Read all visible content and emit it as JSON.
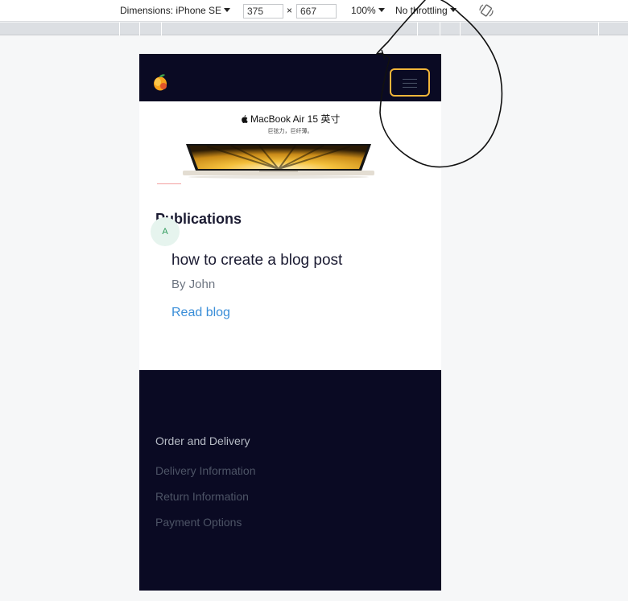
{
  "devtools": {
    "dimensions_label": "Dimensions: iPhone SE",
    "width_value": "375",
    "times": "×",
    "height_value": "667",
    "zoom": "100%",
    "throttling": "No throttling",
    "rotate_icon": "rotate-icon"
  },
  "nav": {
    "logo_icon": "mango-logo-icon",
    "menu_icon": "hamburger-menu-icon",
    "accent_color": "#f1b53a",
    "background_color": "#0a0a23"
  },
  "banner": {
    "title": "MacBook Air 15 英寸",
    "subtitle": "巨弦力，巨纤薄。"
  },
  "publications": {
    "heading": "Publications",
    "avatar_letter": "A",
    "posts": [
      {
        "title": "how to create a blog post",
        "author": "By John",
        "link_label": "Read blog"
      }
    ]
  },
  "footer": {
    "heading": "Order and Delivery",
    "items": [
      "Delivery Information",
      "Return Information",
      "Payment Options"
    ]
  }
}
